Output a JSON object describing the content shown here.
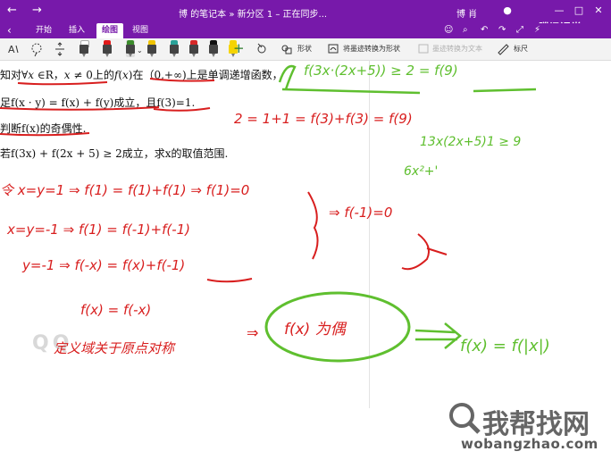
{
  "titlebar": {
    "title": "博 的笔记本 » 新分区 1 – 正在同步...",
    "user": "博 肖",
    "minimize": "—",
    "restore": "□",
    "close": "✕"
  },
  "tabs": {
    "back": "‹",
    "items": [
      "开始",
      "插入",
      "绘图",
      "视图"
    ],
    "active": "绘图"
  },
  "toolbar": {
    "shapes_label": "形状",
    "ink_to_shape_label": "将墨迹转换为形状",
    "ink_to_text_label": "墨迹转换为文本",
    "ruler_label": "标尺",
    "add": "+",
    "pens": [
      {
        "color": "#ffffff"
      },
      {
        "color": "#e11b1b"
      },
      {
        "color": "#3b8b2b"
      },
      {
        "color": "#f0c400"
      },
      {
        "color": "#2aa198"
      },
      {
        "color": "#d62828"
      },
      {
        "color": "#111111"
      },
      {
        "color": "#222222"
      },
      {
        "color": "#f5d400"
      }
    ]
  },
  "brand": {
    "tencent": "腾讯课堂"
  },
  "document": {
    "line1_a": "知对∀",
    "line1_x": "x",
    "line1_b": " ∈R，",
    "line1_c": "x",
    "line1_d": " ≠ 0上的",
    "line1_e": "f",
    "line1_f": "(",
    "line1_g": "x",
    "line1_h": ")在（0,+∞)上是单调递增函数，",
    "line2": "足f(x · y) = f(x) + f(y)成立，且f(3)=1.",
    "line3": "判断f(x)的奇偶性.",
    "line4": "若f(3x) + f(2x + 5) ≥ 2成立，求x的取值范围."
  },
  "handwriting": {
    "green_top_right": "f(3x·(2x+5)) ≥ 2 = f(9)",
    "red_line_2": "2 = 1+1 = f(3)+f(3) = f(9)",
    "green_mid_right_1": "13x(2x+5)1 ≥ 9",
    "green_mid_right_2": "6x²+'",
    "red_step_1": "令 x=y=1 ⇒ f(1) = f(1)+f(1) ⇒ f(1)=0",
    "red_step_2": "x=y=-1 ⇒ f(1) = f(-1)+f(-1)",
    "red_result": "⇒ f(-1)=0",
    "red_step_3": "y=-1 ⇒ f(-x) = f(x)+f(-1)",
    "red_step_4": "f(x) = f(-x)",
    "red_step_5": "定义域关于原点对称",
    "red_arrow_text": "⇒",
    "red_circled": "f(x) 为偶",
    "green_final": "f(x) = f(|x|)"
  },
  "watermark": {
    "faint": "QQ",
    "site_cn": "我帮找网",
    "site_url": "wobangzhao.com"
  },
  "colors": {
    "titlebar": "#7719aa",
    "ink_red": "#d81e1e",
    "ink_green": "#5fbf2f"
  }
}
